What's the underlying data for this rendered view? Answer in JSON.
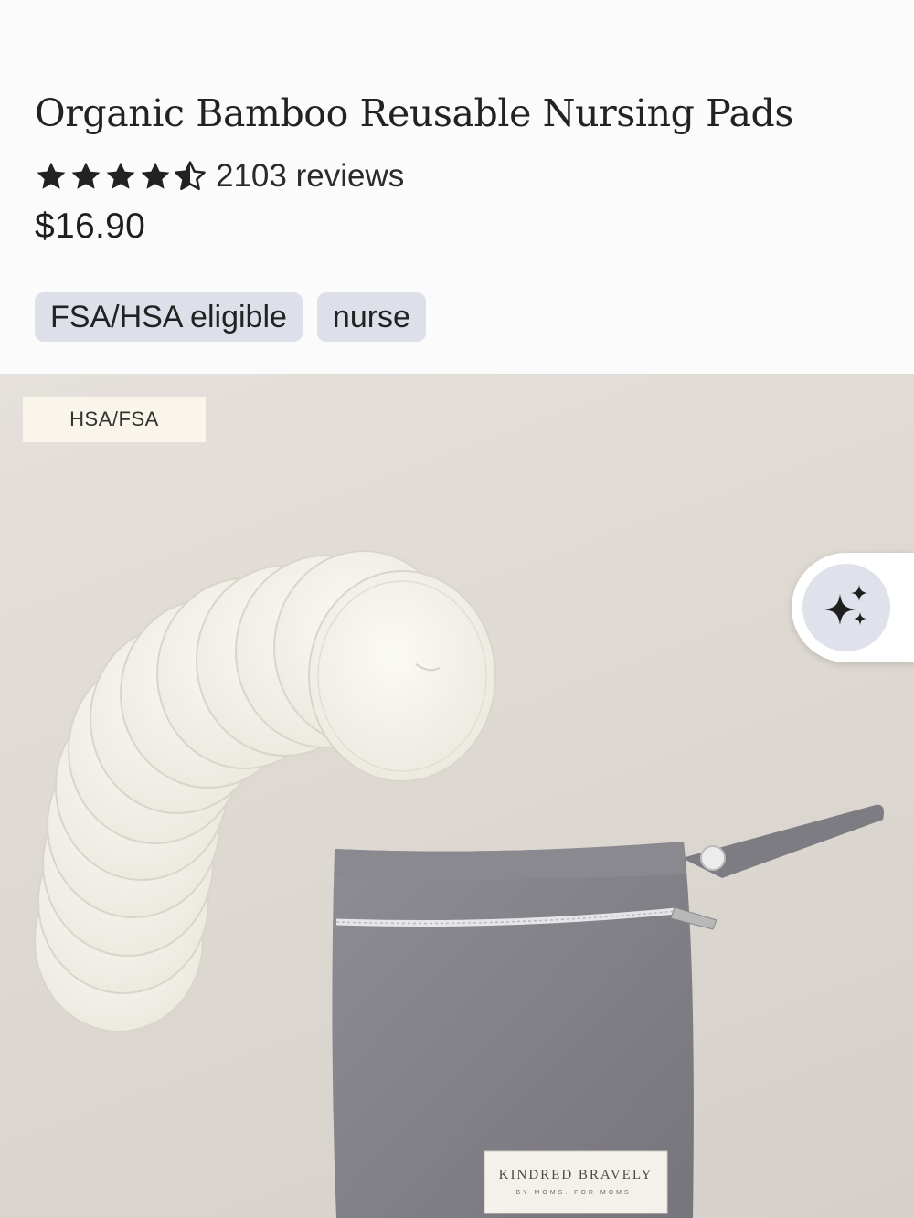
{
  "product": {
    "title": "Organic Bamboo Reusable Nursing Pads",
    "rating": 4.5,
    "rating_max": 5,
    "reviews_label": "2103 reviews",
    "price": "$16.90"
  },
  "tags": [
    {
      "label": "FSA/HSA eligible"
    },
    {
      "label": "nurse"
    }
  ],
  "hero_image": {
    "badge": "HSA/FSA",
    "bag_label_brand": "KINDRED BRAVELY",
    "bag_label_tagline": "BY MOMS. FOR MOMS.",
    "ai_button_icon": "sparkles-icon"
  },
  "colors": {
    "tag_bg": "#dde0e8",
    "star": "#222222",
    "badge_bg": "#faf5ea"
  }
}
